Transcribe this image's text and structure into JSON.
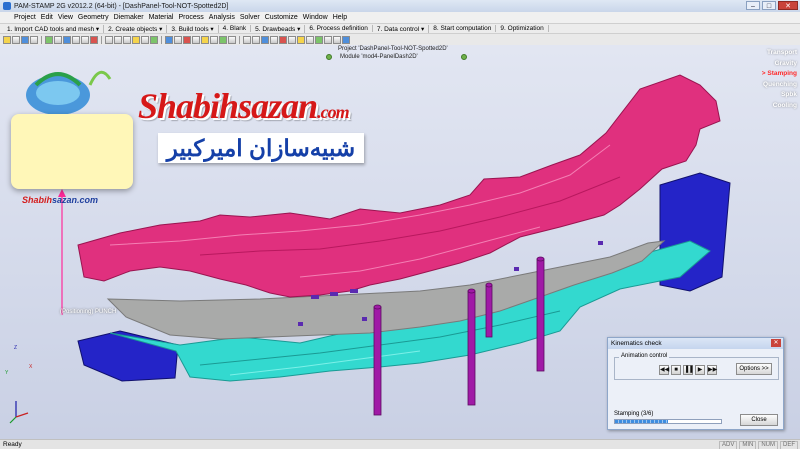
{
  "window": {
    "title": "PAM-STAMP 2G v2012.2 (64-bit) - [DashPanel-Tool-NOT-Spotted2D]",
    "minimize": "–",
    "maximize": "□",
    "close": "✕"
  },
  "menu": [
    "Project",
    "Edit",
    "View",
    "Geometry",
    "Diemaker",
    "Material",
    "Process",
    "Analysis",
    "Solver",
    "Customize",
    "Window",
    "Help"
  ],
  "wizard_steps": [
    "1. Import CAD tools and mesh ▾",
    "2. Create objects ▾",
    "3. Build tools ▾",
    "4. Blank",
    "5. Drawbeads ▾",
    "6. Process definition",
    "7. Data control ▾",
    "8. Start computation",
    "9. Optimization"
  ],
  "viewport": {
    "project": "Project 'DashPanel-Tool-NOT-Spotted2D'",
    "module": "Module 'mod4-PanelDash2D'",
    "punch_label": "(Positioning) PUNCH",
    "axis_z": "Z",
    "axis_x": "X",
    "axis_y": "Y"
  },
  "stages": {
    "items": [
      "Transport",
      "Gravity",
      "> Stamping",
      "Quenching",
      "Spbk",
      "Cooling"
    ],
    "active_index": 2,
    "active_color": "#ff2a2a"
  },
  "branding": {
    "latin_main": "Shabihsazan",
    "latin_domain": ".com",
    "persian": "شبیه‌سازان امیرکبیر",
    "card_label_a": "Shabih",
    "card_label_b": "sazan.com",
    "red": "#d61818",
    "blue": "#1540a8"
  },
  "kinematics": {
    "title": "Kinematics check",
    "close_x": "✕",
    "group_label": "Animation control",
    "controls": [
      "◀◀",
      "■",
      "▐▐",
      "▶",
      "▶▶"
    ],
    "options_label": "Options >>",
    "status": "Stamping (3/6)",
    "progress_fraction": 0.5,
    "close_label": "Close"
  },
  "status": {
    "ready": "Ready",
    "indicators": [
      "ADV",
      "MIN",
      "NUM",
      "DEF"
    ]
  },
  "colors": {
    "die": "#e0307e",
    "blank": "#a9aaa9",
    "punch": "#33d9cf",
    "binder": "#2424c8",
    "pins": "#a01aa6"
  }
}
